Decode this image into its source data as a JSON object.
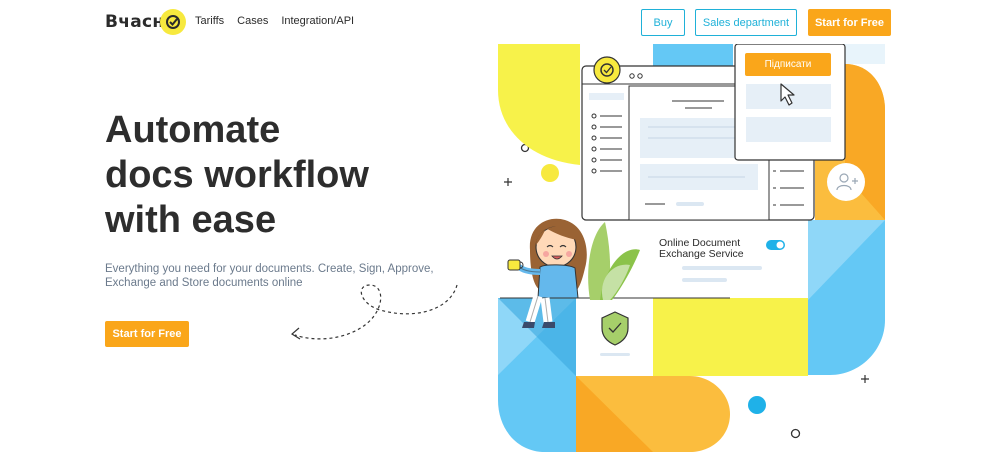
{
  "header": {
    "logo_text": "Вчасн",
    "nav": [
      {
        "label": "Tariffs"
      },
      {
        "label": "Cases"
      },
      {
        "label": "Integration/API"
      }
    ],
    "buy_label": "Buy",
    "sales_label": "Sales department",
    "start_label": "Start for Free"
  },
  "hero": {
    "title_lines": [
      "Automate",
      "docs workflow",
      "with ease"
    ],
    "subtitle_lines": [
      "Everything you need for your documents. Create, Sign, Approve,",
      "Exchange and Store documents online"
    ],
    "cta_label": "Start for Free"
  },
  "illustration": {
    "sign_button_label": "Підписати",
    "card_label_lines": [
      "Online Document",
      "Exchange Service"
    ]
  },
  "colors": {
    "accent_orange": "#faa61a",
    "accent_blue": "#1fb1d8",
    "yellow": "#f7e93e",
    "sky": "#64c8f5"
  }
}
